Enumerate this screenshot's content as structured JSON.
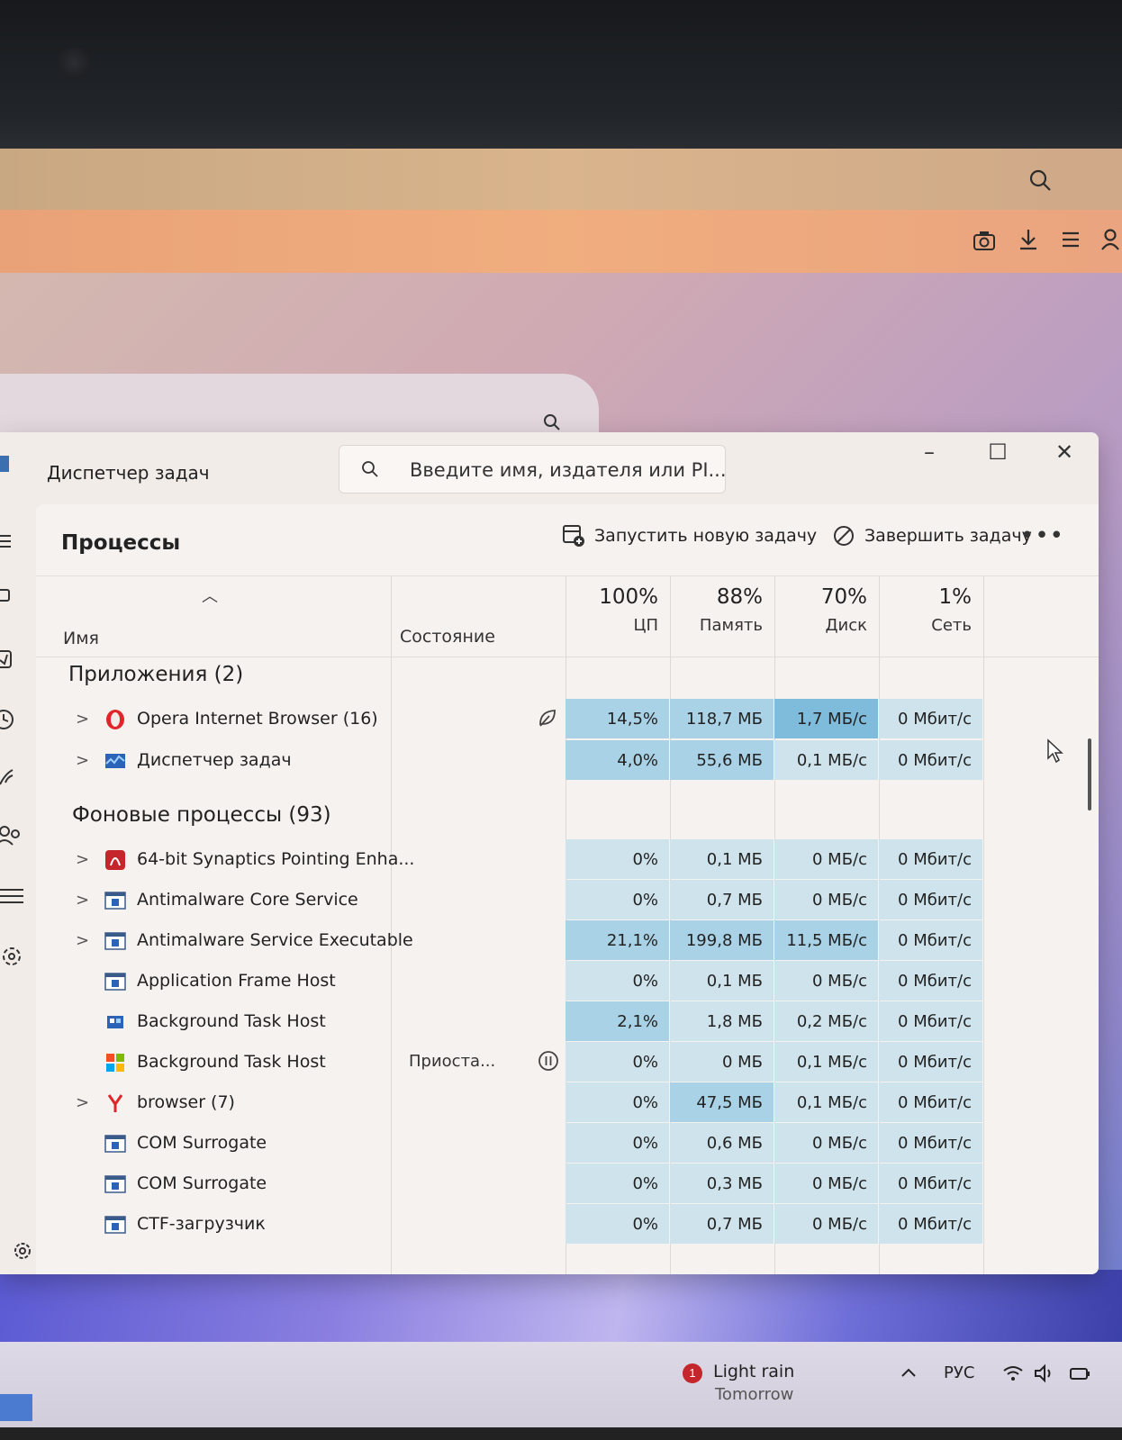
{
  "window": {
    "title": "Диспетчер задач",
    "search_placeholder": "Введите имя, издателя или PI...",
    "controls": {
      "minimize": "–",
      "maximize": "☐",
      "close": "✕"
    }
  },
  "sidebar": {
    "items": [
      {
        "name": "menu",
        "icon": "hamburger-icon"
      },
      {
        "name": "processes",
        "icon": "processes-icon"
      },
      {
        "name": "performance",
        "icon": "performance-icon"
      },
      {
        "name": "app-history",
        "icon": "history-icon"
      },
      {
        "name": "startup",
        "icon": "startup-icon"
      },
      {
        "name": "users",
        "icon": "users-icon"
      },
      {
        "name": "details",
        "icon": "details-icon"
      },
      {
        "name": "services",
        "icon": "services-icon"
      },
      {
        "name": "settings",
        "icon": "settings-icon"
      }
    ]
  },
  "toolbar": {
    "page_title": "Процессы",
    "run_new_task": "Запустить новую задачу",
    "end_task": "Завершить задачу",
    "more": "•••"
  },
  "columns": {
    "name": "Имя",
    "status": "Состояние",
    "cpu": {
      "pct": "100%",
      "label": "ЦП"
    },
    "memory": {
      "pct": "88%",
      "label": "Память"
    },
    "disk": {
      "pct": "70%",
      "label": "Диск"
    },
    "network": {
      "pct": "1%",
      "label": "Сеть"
    }
  },
  "groups": {
    "apps": "Приложения (2)",
    "background": "Фоновые процессы (93)"
  },
  "apps": [
    {
      "name": "Opera Internet Browser (16)",
      "icon": "opera-icon",
      "expandable": true,
      "status_icon": "efficiency-leaf-icon",
      "cpu": "14,5%",
      "mem": "118,7 МБ",
      "disk": "1,7 МБ/с",
      "net": "0 Мбит/с",
      "heat": [
        "md",
        "md",
        "dk",
        "lt"
      ]
    },
    {
      "name": "Диспетчер задач",
      "icon": "task-manager-icon",
      "expandable": true,
      "cpu": "4,0%",
      "mem": "55,6 МБ",
      "disk": "0,1 МБ/с",
      "net": "0 Мбит/с",
      "heat": [
        "md",
        "md",
        "lt",
        "lt"
      ]
    }
  ],
  "background": [
    {
      "name": "64-bit Synaptics Pointing Enha...",
      "icon": "synaptics-icon",
      "expandable": true,
      "cpu": "0%",
      "mem": "0,1 МБ",
      "disk": "0 МБ/с",
      "net": "0 Мбит/с",
      "heat": [
        "lt",
        "lt",
        "lt",
        "lt"
      ]
    },
    {
      "name": "Antimalware Core Service",
      "icon": "window-app-icon",
      "expandable": true,
      "cpu": "0%",
      "mem": "0,7 МБ",
      "disk": "0 МБ/с",
      "net": "0 Мбит/с",
      "heat": [
        "lt",
        "lt",
        "lt",
        "lt"
      ]
    },
    {
      "name": "Antimalware Service Executable",
      "icon": "window-app-icon",
      "expandable": true,
      "cpu": "21,1%",
      "mem": "199,8 МБ",
      "disk": "11,5 МБ/с",
      "net": "0 Мбит/с",
      "heat": [
        "md",
        "md",
        "md",
        "lt"
      ]
    },
    {
      "name": "Application Frame Host",
      "icon": "window-app-icon",
      "expandable": false,
      "cpu": "0%",
      "mem": "0,1 МБ",
      "disk": "0 МБ/с",
      "net": "0 Мбит/с",
      "heat": [
        "lt",
        "lt",
        "lt",
        "lt"
      ]
    },
    {
      "name": "Background Task Host",
      "icon": "background-task-icon",
      "expandable": false,
      "cpu": "2,1%",
      "mem": "1,8 МБ",
      "disk": "0,2 МБ/с",
      "net": "0 Мбит/с",
      "heat": [
        "md",
        "lt",
        "lt",
        "lt"
      ]
    },
    {
      "name": "Background Task Host",
      "icon": "windows-logo-icon",
      "expandable": false,
      "status": "Приоста...",
      "status_icon": "paused-icon",
      "cpu": "0%",
      "mem": "0 МБ",
      "disk": "0,1 МБ/с",
      "net": "0 Мбит/с",
      "heat": [
        "lt",
        "lt",
        "lt",
        "lt"
      ]
    },
    {
      "name": "browser (7)",
      "icon": "yandex-icon",
      "expandable": true,
      "cpu": "0%",
      "mem": "47,5 МБ",
      "disk": "0,1 МБ/с",
      "net": "0 Мбит/с",
      "heat": [
        "lt",
        "md",
        "lt",
        "lt"
      ]
    },
    {
      "name": "COM Surrogate",
      "icon": "window-app-icon",
      "expandable": false,
      "cpu": "0%",
      "mem": "0,6 МБ",
      "disk": "0 МБ/с",
      "net": "0 Мбит/с",
      "heat": [
        "lt",
        "lt",
        "lt",
        "lt"
      ]
    },
    {
      "name": "COM Surrogate",
      "icon": "window-app-icon",
      "expandable": false,
      "cpu": "0%",
      "mem": "0,3 МБ",
      "disk": "0 МБ/с",
      "net": "0 Мбит/с",
      "heat": [
        "lt",
        "lt",
        "lt",
        "lt"
      ]
    },
    {
      "name": "CTF-загрузчик",
      "icon": "window-app-icon",
      "expandable": false,
      "cpu": "0%",
      "mem": "0,7 МБ",
      "disk": "0 МБ/с",
      "net": "0 Мбит/с",
      "heat": [
        "lt",
        "lt",
        "lt",
        "lt"
      ]
    }
  ],
  "taskbar": {
    "weather_badge": "1",
    "weather_line1": "Light rain",
    "weather_line2": "Tomorrow",
    "language": "РУС"
  },
  "colors": {
    "heat_light": "#cfe3ec",
    "heat_medium": "#a9d2e6",
    "heat_dark": "#7fbbdb",
    "browser_toolbar": "#f0ad7e"
  }
}
